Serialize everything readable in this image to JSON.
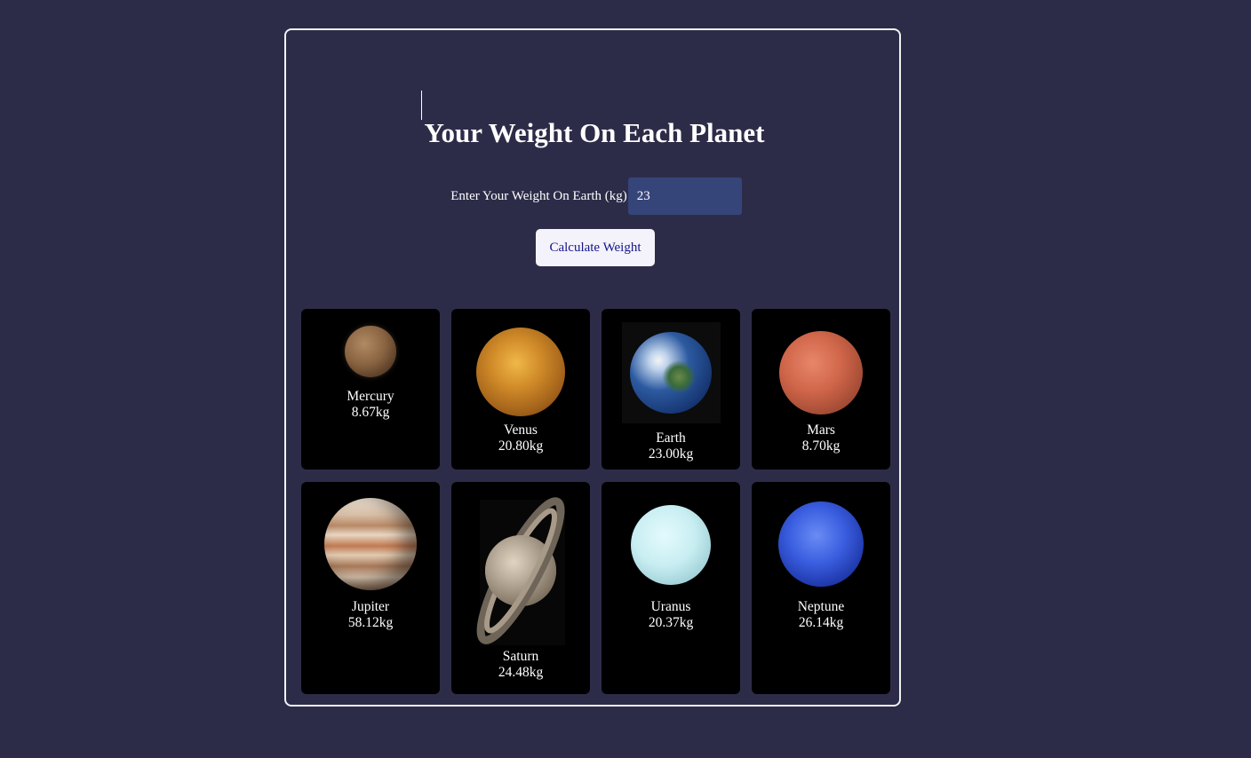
{
  "page": {
    "title": "Your Weight On Each Planet",
    "input_label": "Enter Your Weight On Earth (kg)",
    "input_value": "23",
    "button_label": "Calculate Weight"
  },
  "planets": [
    {
      "name": "Mercury",
      "weight": "8.67kg",
      "color": "#8a6a4a"
    },
    {
      "name": "Venus",
      "weight": "20.80kg",
      "color": "#d08a28"
    },
    {
      "name": "Earth",
      "weight": "23.00kg",
      "color": "#2c5aa0"
    },
    {
      "name": "Mars",
      "weight": "8.70kg",
      "color": "#d0664a"
    },
    {
      "name": "Jupiter",
      "weight": "58.12kg",
      "color": "#d6b49a"
    },
    {
      "name": "Saturn",
      "weight": "24.48kg",
      "color": "#c8b8a0"
    },
    {
      "name": "Uranus",
      "weight": "20.37kg",
      "color": "#c8eef2"
    },
    {
      "name": "Neptune",
      "weight": "26.14kg",
      "color": "#3a5ee0"
    }
  ]
}
